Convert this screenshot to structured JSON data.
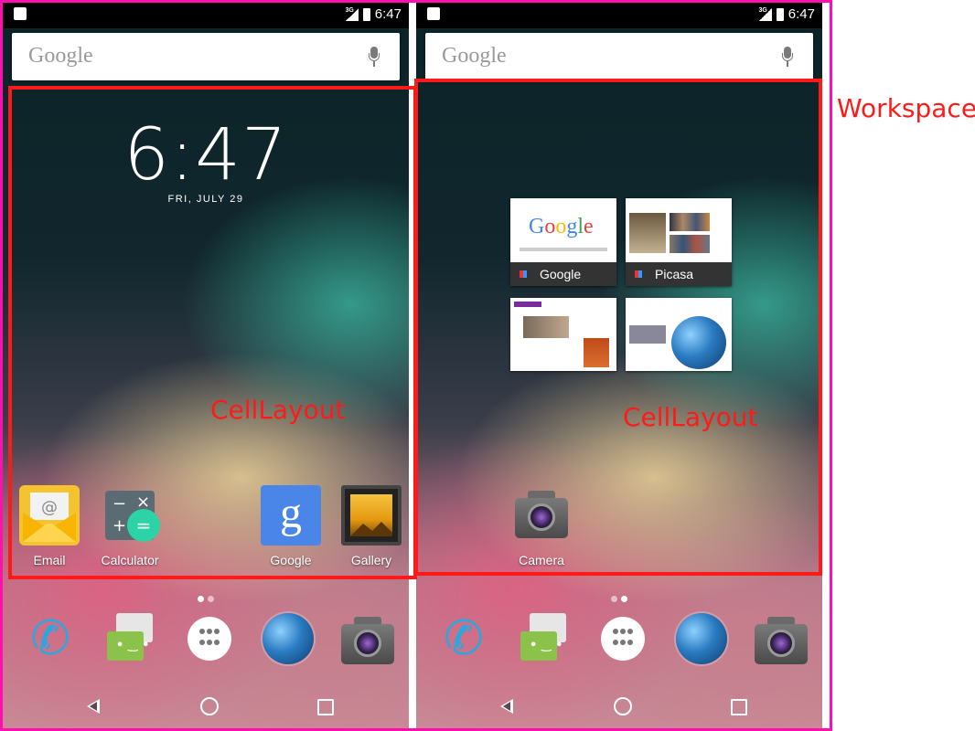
{
  "status": {
    "network": "3G",
    "time": "6:47"
  },
  "search": {
    "placeholder": "Google"
  },
  "lockscreen": {
    "time": "6:47",
    "date": "FRI, JULY 29"
  },
  "left_screen": {
    "apps": [
      {
        "label": "Email",
        "icon": "email-icon"
      },
      {
        "label": "Calculator",
        "icon": "calculator-icon"
      },
      {
        "label": "Google",
        "icon": "google-app-icon"
      },
      {
        "label": "Gallery",
        "icon": "gallery-icon"
      }
    ]
  },
  "right_screen": {
    "widgets": [
      {
        "label": "Google"
      },
      {
        "label": "Picasa"
      },
      {
        "label": ""
      },
      {
        "label": ""
      }
    ],
    "apps": [
      {
        "label": "Camera",
        "icon": "camera-icon"
      }
    ]
  },
  "dock": [
    "phone-icon",
    "messaging-icon",
    "all-apps-icon",
    "browser-icon",
    "camera-icon"
  ],
  "annotations": {
    "celllayout": "CellLayout",
    "workspace": "Workspace",
    "celllayout_color": "#ff1a1a",
    "workspace_color": "#ff0fae"
  }
}
